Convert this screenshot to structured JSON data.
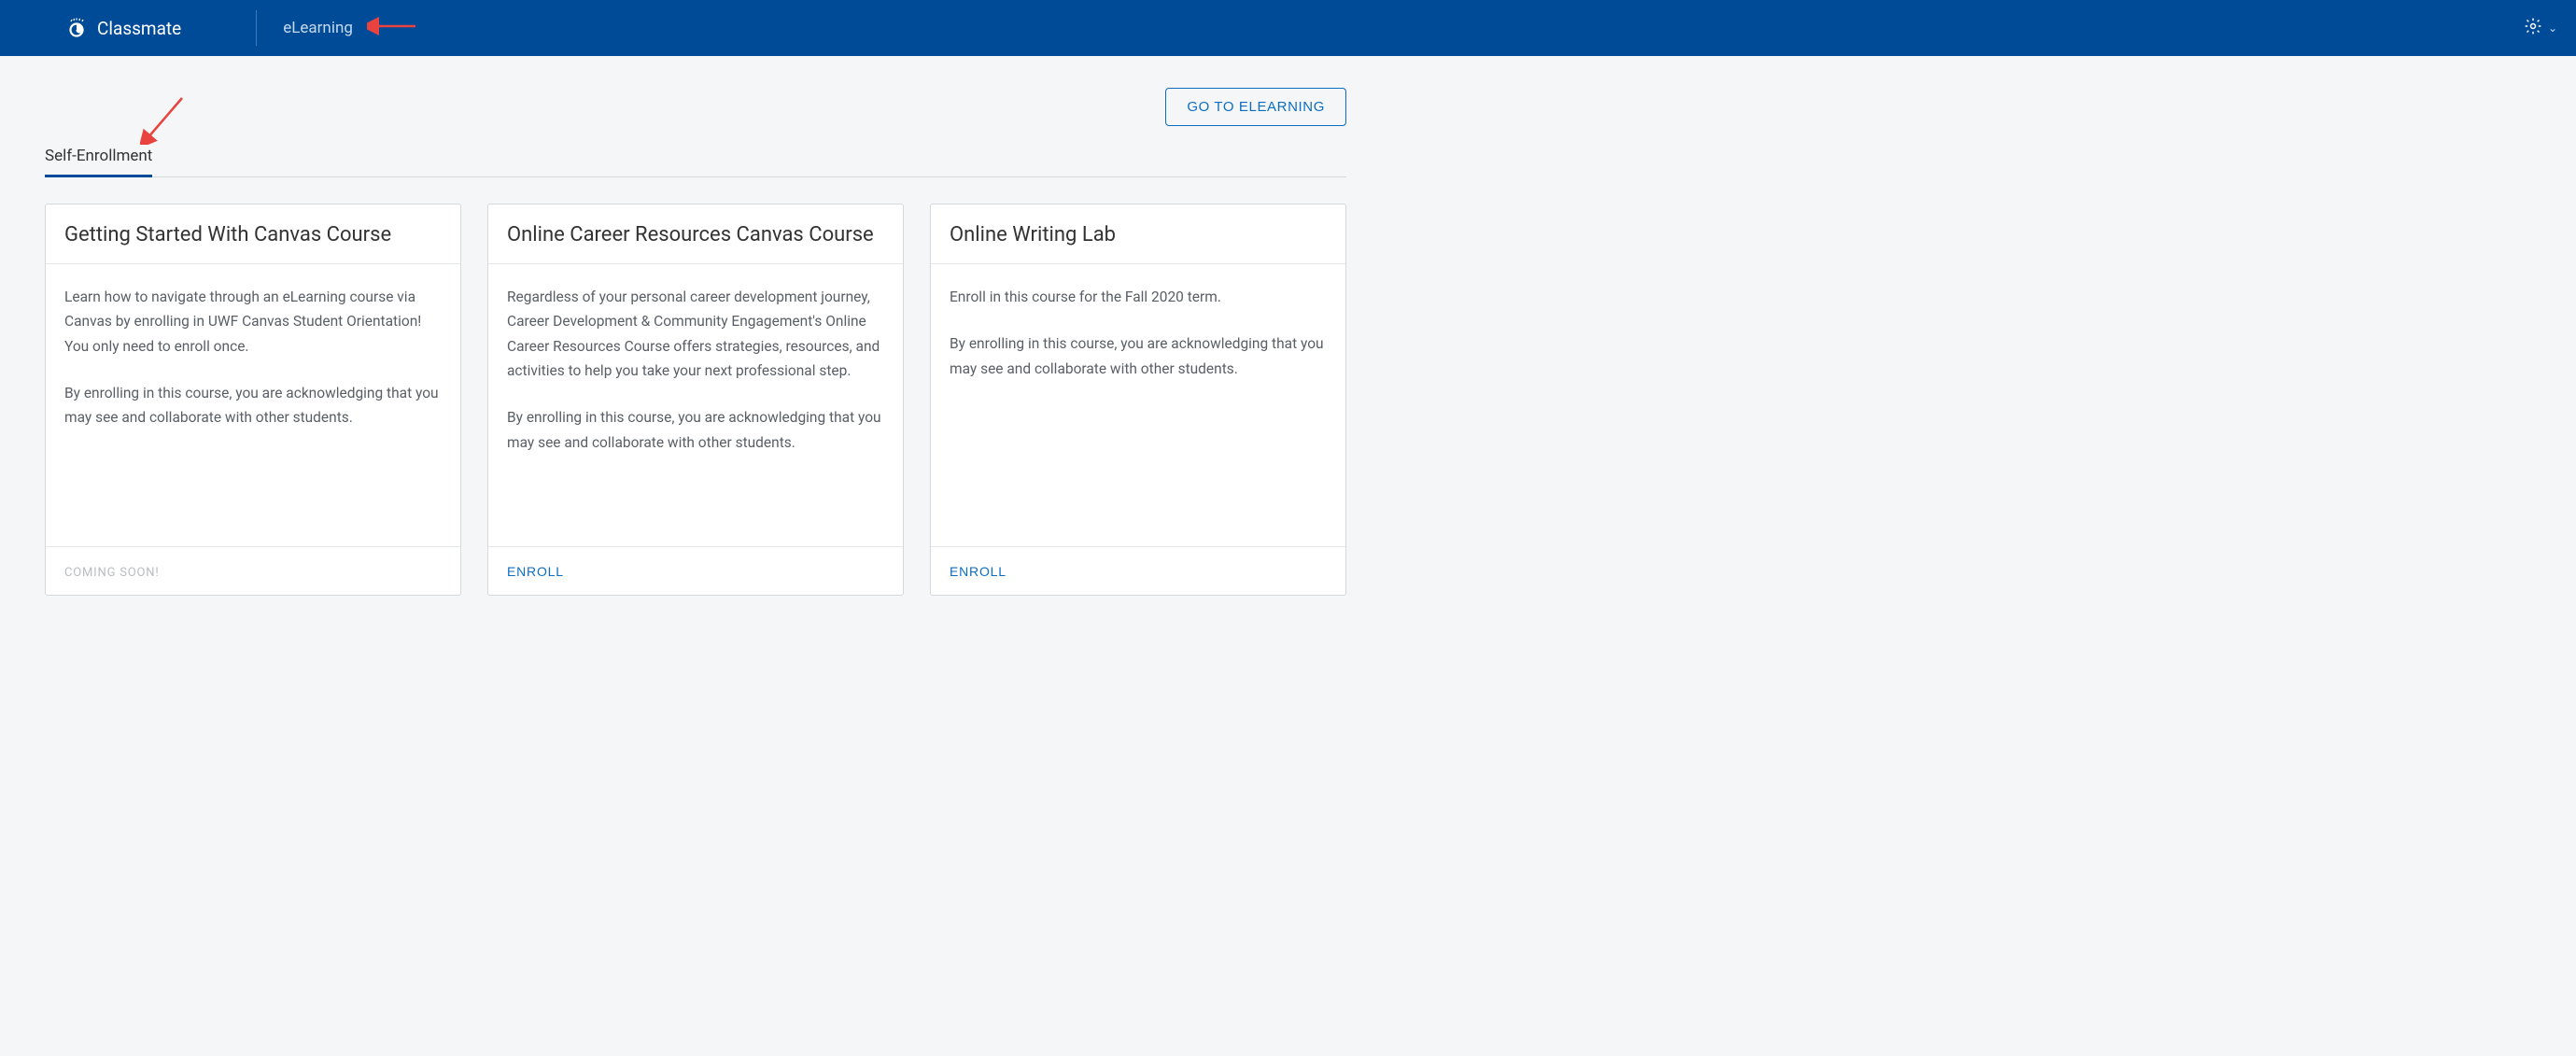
{
  "header": {
    "brand": "Classmate",
    "nav_link": "eLearning"
  },
  "main": {
    "go_to_button": "GO TO ELEARNING",
    "tabs": [
      {
        "label": "Self-Enrollment"
      }
    ],
    "cards": [
      {
        "title": "Getting Started With Canvas Course",
        "paragraphs": [
          "Learn how to navigate through an eLearning course via Canvas by enrolling in UWF Canvas Student Orientation! You only need to enroll once.",
          "By enrolling in this course, you are acknowledging that you may see and collaborate with other students."
        ],
        "footer_type": "coming_soon",
        "footer_label": "COMING SOON!"
      },
      {
        "title": "Online Career Resources Canvas Course",
        "paragraphs": [
          "Regardless of your personal career development journey, Career Development & Community Engagement's Online Career Resources Course offers strategies, resources, and activities to help you take your next professional step.",
          "By enrolling in this course, you are acknowledging that you may see and collaborate with other students."
        ],
        "footer_type": "enroll",
        "footer_label": "ENROLL"
      },
      {
        "title": "Online Writing Lab",
        "paragraphs": [
          "Enroll in this course for the Fall 2020 term.",
          "By enrolling in this course, you are acknowledging that you may see and collaborate with other students."
        ],
        "footer_type": "enroll",
        "footer_label": "ENROLL"
      }
    ]
  }
}
